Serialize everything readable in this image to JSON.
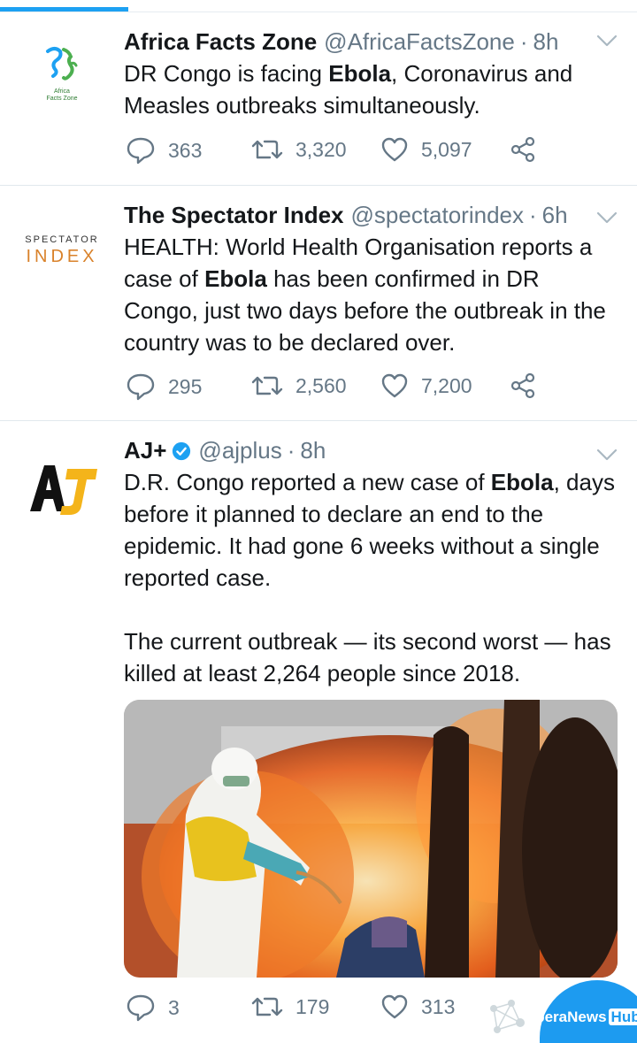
{
  "tweets": [
    {
      "name": "Africa Facts Zone",
      "handle": "@AfricaFactsZone",
      "time": "8h",
      "verified": false,
      "avatar": {
        "icon": "africa-facts-zone-logo",
        "logo_line1": "Africa",
        "logo_line2": "Facts Zone"
      },
      "text_parts": [
        "DR Congo is facing ",
        "Ebola",
        ", Coronavirus and Measles outbreaks simultaneously."
      ],
      "stats": {
        "replies": "363",
        "retweets": "3,320",
        "likes": "5,097"
      }
    },
    {
      "name": "The Spectator Index",
      "handle": "@spectatorindex",
      "time": "6h",
      "verified": false,
      "avatar": {
        "icon": "spectator-index-logo",
        "logo_line1": "SPECTATOR",
        "logo_line2": "INDEX"
      },
      "text_parts": [
        "HEALTH: World Health Organisation reports a case of ",
        "Ebola",
        " has been confirmed in DR Congo, just two days before the outbreak in the country was to be declared over."
      ],
      "stats": {
        "replies": "295",
        "retweets": "2,560",
        "likes": "7,200"
      }
    },
    {
      "name": "AJ+",
      "handle": "@ajplus",
      "time": "8h",
      "verified": true,
      "avatar": {
        "icon": "ajplus-logo"
      },
      "text_parts": [
        "D.R. Congo reported a new case of ",
        "Ebola",
        ", days before it planned to declare an end to the epidemic. It had gone 6 weeks without a single reported case."
      ],
      "text_para2": "The current outbreak — its second worst — has killed at least 2,264 people since 2018.",
      "media": {
        "icon": "ebola-burning-photo"
      },
      "stats": {
        "replies": "3",
        "retweets": "179",
        "likes": "313"
      }
    }
  ],
  "watermark": {
    "text": "OperaNews",
    "hub": "Hub"
  },
  "colors": {
    "accent": "#1da1f2",
    "secondary_text": "#657786",
    "divider": "#e1e8ed"
  },
  "icons": [
    "reply-icon",
    "retweet-icon",
    "like-icon",
    "share-icon",
    "caret-down-icon",
    "verified-badge-icon"
  ]
}
